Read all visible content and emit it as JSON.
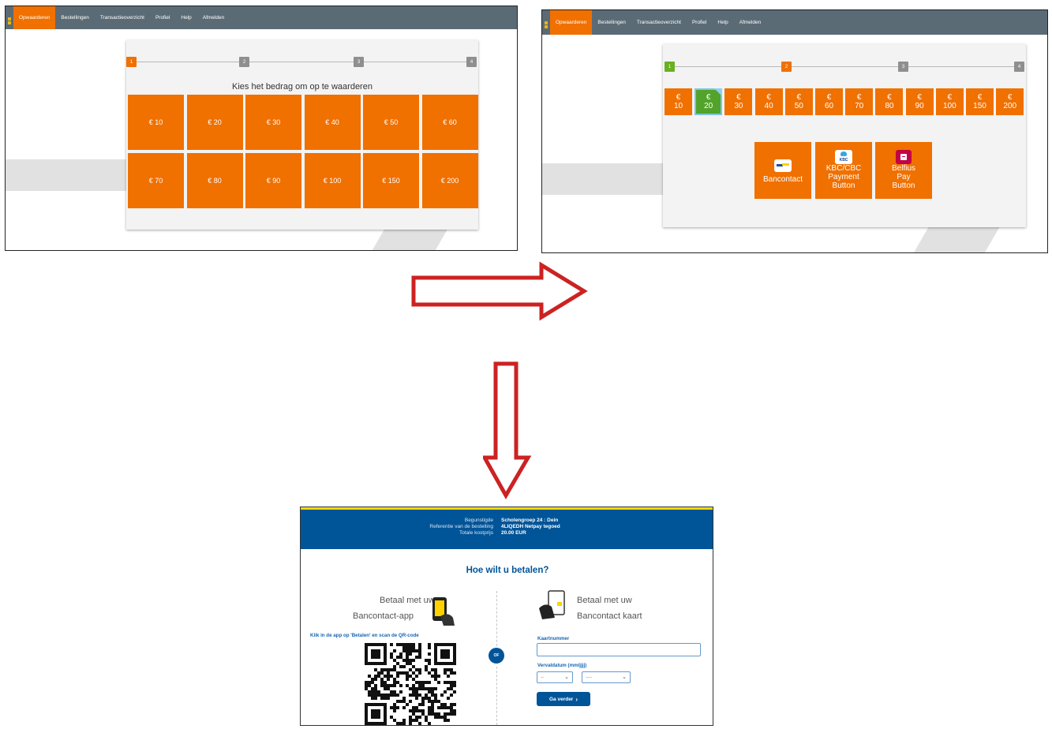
{
  "nav": {
    "items": [
      "Opwaarderen",
      "Bestellingen",
      "Transactieoverzicht",
      "Profiel",
      "Help",
      "Afmelden"
    ],
    "active": "Opwaarderen"
  },
  "step1": {
    "steps": [
      "1",
      "2",
      "3",
      "4"
    ],
    "heading": "Kies het bedrag om op te waarderen",
    "amounts": [
      "€ 10",
      "€ 20",
      "€ 30",
      "€ 40",
      "€ 50",
      "€ 60",
      "€ 70",
      "€ 80",
      "€ 90",
      "€ 100",
      "€ 150",
      "€ 200"
    ]
  },
  "step2": {
    "steps": [
      "1",
      "2",
      "3",
      "4"
    ],
    "currency": "€",
    "amounts": [
      "10",
      "20",
      "30",
      "40",
      "50",
      "60",
      "70",
      "80",
      "90",
      "100",
      "150",
      "200"
    ],
    "selected_amount": "20",
    "payment_methods": [
      {
        "label": "Bancontact",
        "icon": "bancontact-logo-icon"
      },
      {
        "label": "KBC/CBC Payment Button",
        "line1": "KBC/CBC",
        "line2": "Payment",
        "line3": "Button",
        "icon": "kbc-logo-icon",
        "logo_text": "KBC"
      },
      {
        "label": "Belfius Pay Button",
        "line1": "Belfius",
        "line2": "Pay",
        "line3": "Button",
        "icon": "belfius-logo-icon"
      }
    ]
  },
  "payment": {
    "beneficiary_label": "Begunstigde",
    "beneficiary_value": "Scholengroep 24 : Dein",
    "reference_label": "Referentie van de bestelling",
    "reference_value": "4LIQEDH Netpay tegoed",
    "total_label": "Totale kostprijs",
    "total_value": "20.00 EUR",
    "title": "Hoe wilt u betalen?",
    "app_line1": "Betaal met uw",
    "app_line2": "Bancontact-app",
    "app_instruction": "Klik in de app op 'Betalen' en scan de QR-code",
    "or_label": "OF",
    "card_line1": "Betaal met uw",
    "card_line2": "Bancontact kaart",
    "card_number_label": "Kaartnummer",
    "card_number_value": "",
    "expiry_label": "Vervaldatum (mm/jjjj)",
    "month_value": "--",
    "year_value": "----",
    "continue_label": "Ga verder"
  },
  "colors": {
    "accent": "#f07000",
    "navbar": "#5b6b76",
    "selected": "#52a32a",
    "bancontact_blue": "#005498",
    "arrow_red": "#cc2222"
  }
}
